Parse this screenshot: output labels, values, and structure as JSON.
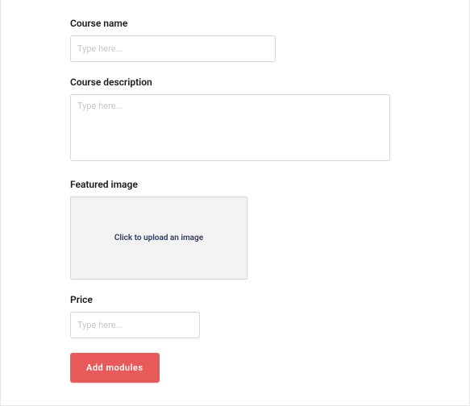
{
  "form": {
    "course_name": {
      "label": "Course name",
      "placeholder": "Type here..."
    },
    "course_description": {
      "label": "Course description",
      "placeholder": "Type here..."
    },
    "featured_image": {
      "label": "Featured image",
      "upload_text": "Click to upload an image"
    },
    "price": {
      "label": "Price",
      "placeholder": "Type here..."
    },
    "add_modules_label": "Add modules"
  }
}
